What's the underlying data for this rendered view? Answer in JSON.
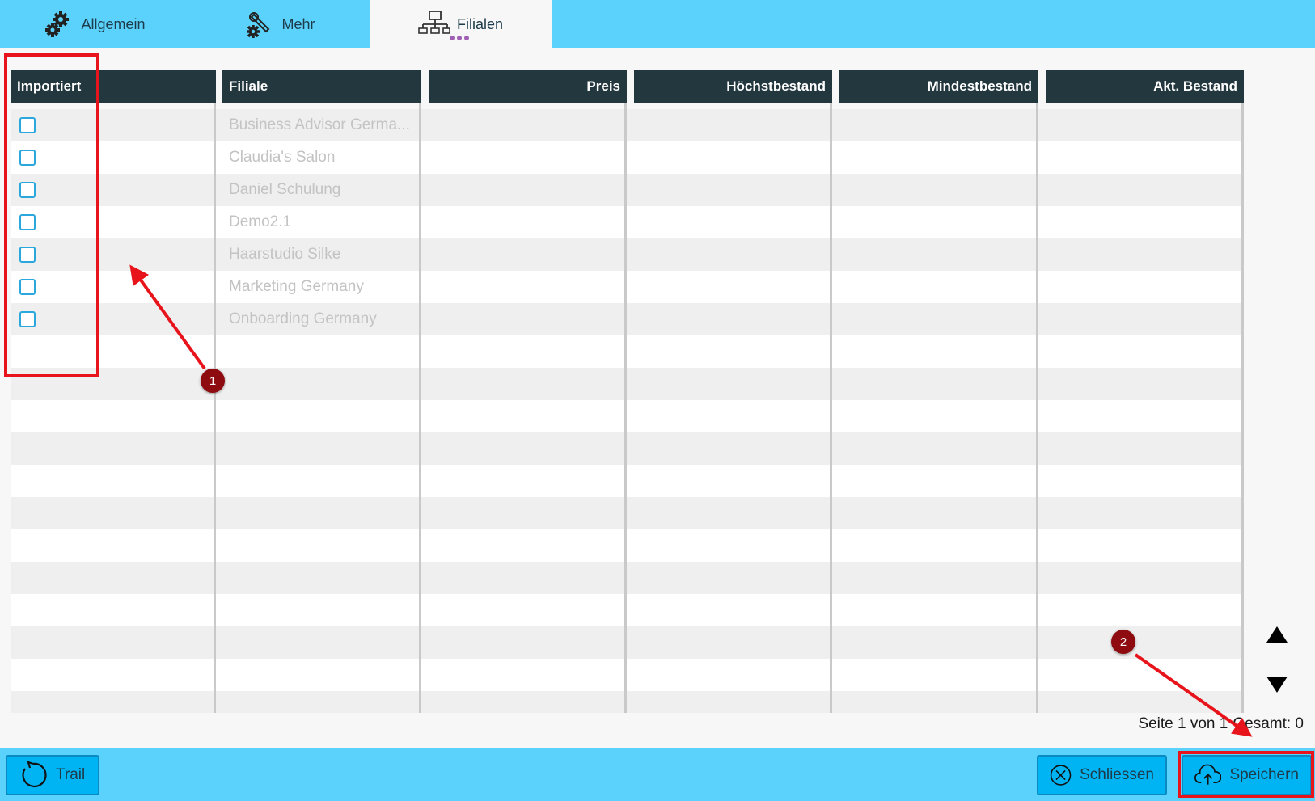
{
  "tabs": [
    {
      "label": "Allgemein",
      "icon": "gears-icon"
    },
    {
      "label": "Mehr",
      "icon": "gear-wrench-icon"
    },
    {
      "label": "Filialen",
      "icon": "network-icon",
      "active": true
    }
  ],
  "table": {
    "columns": [
      "Importiert",
      "Filiale",
      "Preis",
      "Höchstbestand",
      "Mindestbestand",
      "Akt. Bestand"
    ],
    "rows": [
      {
        "filiale": "Business Advisor Germa...",
        "importiert": false
      },
      {
        "filiale": "Claudia's Salon",
        "importiert": false
      },
      {
        "filiale": "Daniel Schulung",
        "importiert": false
      },
      {
        "filiale": "Demo2.1",
        "importiert": false
      },
      {
        "filiale": "Haarstudio Silke",
        "importiert": false
      },
      {
        "filiale": "Marketing Germany",
        "importiert": false
      },
      {
        "filiale": "Onboarding Germany",
        "importiert": false
      }
    ]
  },
  "pager": {
    "page": "Seite 1 von 1",
    "total": "Gesamt: 0"
  },
  "buttons": {
    "trail": "Trail",
    "close": "Schliessen",
    "save": "Speichern"
  },
  "annotations": [
    "1",
    "2"
  ],
  "colors": {
    "accent": "#5bd2fb",
    "button": "#00b4f4",
    "header": "#23373f",
    "highlight": "#e8141b",
    "badge": "#8e0b10"
  }
}
